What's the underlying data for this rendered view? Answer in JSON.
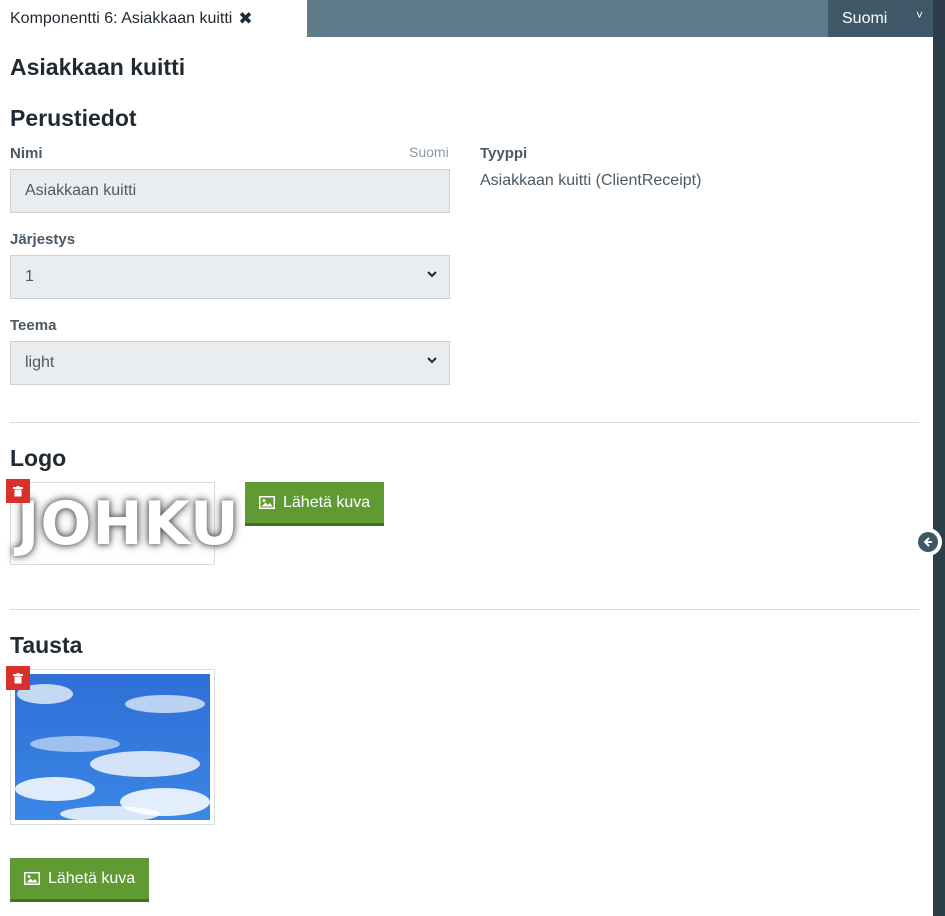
{
  "tab": {
    "title": "Komponentti 6: Asiakkaan kuitti"
  },
  "language_select": {
    "value": "Suomi"
  },
  "page": {
    "title": "Asiakkaan kuitti"
  },
  "basic_info": {
    "heading": "Perustiedot",
    "name_label": "Nimi",
    "name_language": "Suomi",
    "name_value": "Asiakkaan kuitti",
    "order_label": "Järjestys",
    "order_value": "1",
    "theme_label": "Teema",
    "theme_value": "light",
    "type_label": "Tyyppi",
    "type_value": "Asiakkaan kuitti (ClientReceipt)"
  },
  "logo": {
    "heading": "Logo",
    "image_text": "JOHKU",
    "upload_label": "Lähetä kuva"
  },
  "background": {
    "heading": "Tausta",
    "upload_label": "Lähetä kuva"
  },
  "colors": {
    "accent_green": "#5f9a32",
    "delete_red": "#d9302b",
    "topbar": "#5f7a89"
  }
}
